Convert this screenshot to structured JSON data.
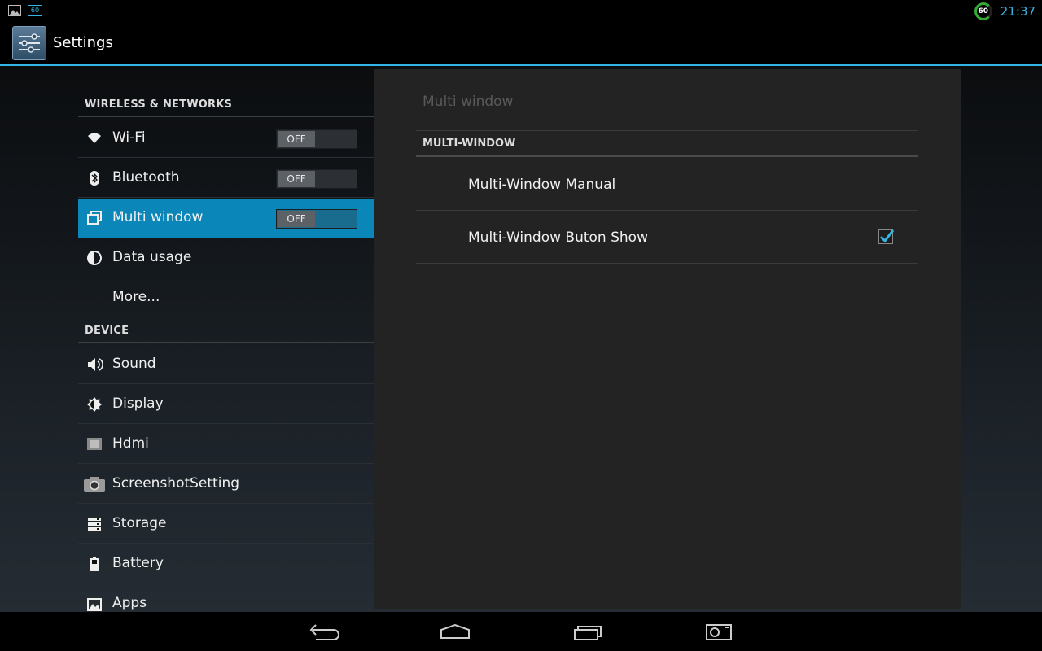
{
  "status_bar": {
    "left_icons": [
      "picture-icon",
      "fps-badge-icon"
    ],
    "badge_text": "60",
    "fps_value": "60",
    "clock": "21:37",
    "colors": {
      "clock": "#33b5e5",
      "fps_ring": "#33aa33"
    }
  },
  "action_bar": {
    "icon": "settings-sliders-icon",
    "title": "Settings"
  },
  "sidebar": {
    "categories": [
      {
        "label": "WIRELESS & NETWORKS"
      },
      {
        "label": "DEVICE"
      }
    ],
    "items": [
      {
        "label": "Wi-Fi",
        "icon": "wifi-icon",
        "toggle": "OFF"
      },
      {
        "label": "Bluetooth",
        "icon": "bluetooth-icon",
        "toggle": "OFF"
      },
      {
        "label": "Multi window",
        "icon": "multi-window-icon",
        "toggle": "OFF",
        "selected": true
      },
      {
        "label": "Data usage",
        "icon": "data-usage-icon"
      },
      {
        "label": "More..."
      },
      {
        "label": "Sound",
        "icon": "sound-icon"
      },
      {
        "label": "Display",
        "icon": "display-icon"
      },
      {
        "label": "Hdmi",
        "icon": "hdmi-icon"
      },
      {
        "label": "ScreenshotSetting",
        "icon": "camera-icon"
      },
      {
        "label": "Storage",
        "icon": "storage-icon"
      },
      {
        "label": "Battery",
        "icon": "battery-icon"
      },
      {
        "label": "Apps",
        "icon": "apps-icon"
      }
    ],
    "colors": {
      "selected": "#0a86b8"
    }
  },
  "panel": {
    "title": "Multi window",
    "category": "MULTI-WINDOW",
    "items": [
      {
        "label": "Multi-Window Manual"
      },
      {
        "label": "Multi-Window Buton Show",
        "checked": true
      }
    ],
    "colors": {
      "checkbox": "#33b5e5"
    }
  },
  "nav_bar": {
    "buttons": [
      "back-icon",
      "home-icon",
      "recent-apps-icon",
      "screenshot-icon"
    ]
  }
}
